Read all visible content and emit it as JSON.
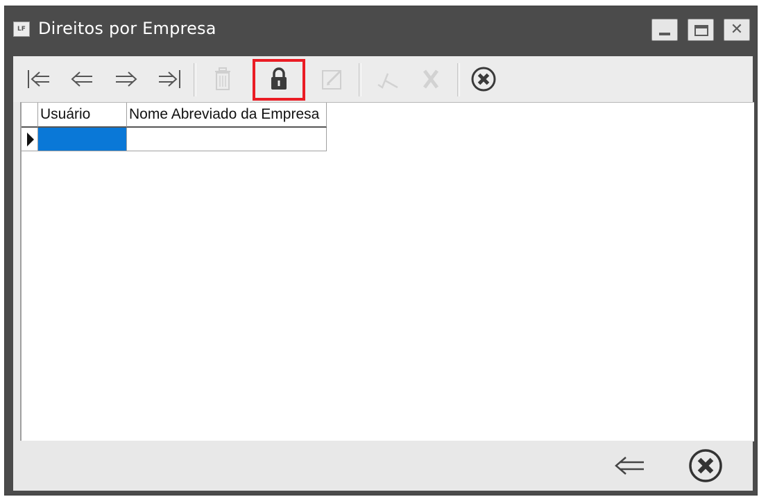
{
  "window": {
    "app_icon_text": "LF",
    "title": "Direitos por Empresa"
  },
  "toolbar": {
    "buttons": [
      {
        "name": "first-record",
        "icon": "first-arrow-icon",
        "enabled": true
      },
      {
        "name": "previous-record",
        "icon": "left-arrow-icon",
        "enabled": true
      },
      {
        "name": "next-record",
        "icon": "right-arrow-icon",
        "enabled": true
      },
      {
        "name": "last-record",
        "icon": "last-arrow-icon",
        "enabled": true
      },
      {
        "name": "delete",
        "icon": "trash-icon",
        "enabled": false
      },
      {
        "name": "lock",
        "icon": "lock-icon",
        "enabled": true,
        "highlighted": true
      },
      {
        "name": "edit",
        "icon": "edit-icon",
        "enabled": false
      },
      {
        "name": "confirm",
        "icon": "check-icon",
        "enabled": false
      },
      {
        "name": "cancel-edit",
        "icon": "x-icon",
        "enabled": false
      },
      {
        "name": "close",
        "icon": "close-circle-icon",
        "enabled": true
      }
    ],
    "highlight_color": "#ea1c24"
  },
  "grid": {
    "columns": [
      "Usuário",
      "Nome Abreviado da Empresa"
    ],
    "rows": [
      {
        "usuario": "",
        "empresa": ""
      }
    ],
    "selected_cell_color": "#0a78d7"
  },
  "footer": {
    "buttons": [
      {
        "name": "back",
        "icon": "back-arrow-icon"
      },
      {
        "name": "exit",
        "icon": "close-circle-icon"
      }
    ]
  }
}
